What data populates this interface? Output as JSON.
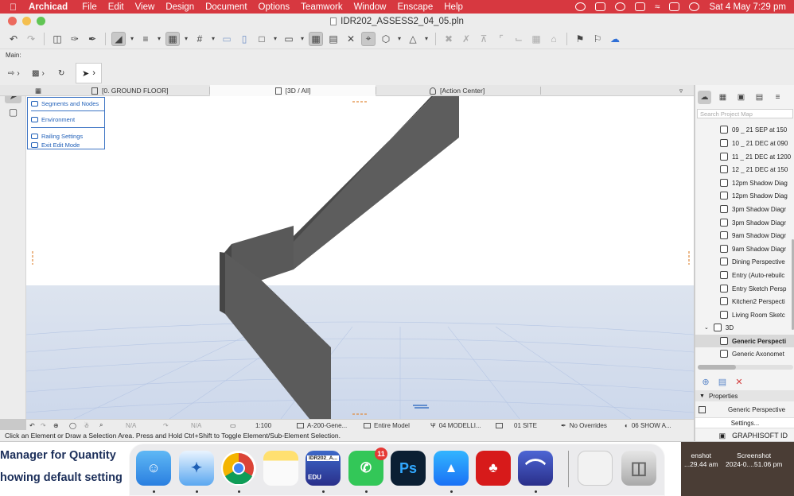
{
  "menubar": {
    "app": "Archicad",
    "items": [
      "File",
      "Edit",
      "View",
      "Design",
      "Document",
      "Options",
      "Teamwork",
      "Window",
      "Enscape",
      "Help"
    ],
    "clock": "Sat 4 May  7:29 pm"
  },
  "window": {
    "title": "IDR202_ASSESS2_04_05.pln"
  },
  "infobox": {
    "label": "Main:"
  },
  "tabs": [
    {
      "label": "[0. GROUND FLOOR]"
    },
    {
      "label": "[3D / All]"
    },
    {
      "label": "[Action Center]"
    }
  ],
  "context_menu": {
    "items": [
      "Segments and Nodes",
      "Environment",
      "Railing Settings",
      "Exit Edit Mode"
    ]
  },
  "status": {
    "na1": "N/A",
    "na2": "N/A",
    "scale": "1:100",
    "layer": "A-200-Gene...",
    "model": "Entire Model",
    "pen": "04 MODELLI...",
    "site": "01 SITE",
    "overrides": "No Overrides",
    "show": "06 SHOW A...",
    "hint": "Click an Element or Draw a Selection Area. Press and Hold Ctrl+Shift to Toggle Element/Sub-Element Selection."
  },
  "navigator": {
    "search_placeholder": "Search Project Map",
    "items": [
      "09 _ 21 SEP at 150",
      "10 _ 21 DEC at 090",
      "11 _ 21 DEC at 1200",
      "12 _ 21 DEC at 150",
      "12pm Shadow Diag",
      "12pm Shadow Diag",
      "3pm Shadow Diagr",
      "3pm Shadow Diagr",
      "9am Shadow Diagr",
      "9am Shadow Diagr",
      "Dining Perspective",
      "Entry (Auto-rebuilc",
      "Entry Sketch Persp",
      "Kitchen2 Perspecti",
      "Living Room Sketc"
    ],
    "folder": "3D",
    "sub_items": [
      "Generic Perspecti",
      "Generic Axonomet"
    ],
    "properties_label": "Properties",
    "properties_value": "Generic Perspective",
    "settings_label": "Settings...",
    "brand": "GRAPHISOFT ID"
  },
  "behind": {
    "line1": "Manager for Quantity",
    "line2": "howing default setting",
    "shot1_title": "enshot",
    "shot1_time": "...29.44 am",
    "shot2_title": "Screenshot",
    "shot2_time": "2024-0....51.06 pm"
  },
  "dock": {
    "archicad_label": "IDR202_A...",
    "archicad_sub": "EDU",
    "whatsapp_badge": "11",
    "ps_label": "Ps"
  },
  "colors": {
    "menubar": "#d73840",
    "selection_blue": "#1f5fb8",
    "railing_gray": "#5c5c5c",
    "floor_blue": "#d7e0ee"
  }
}
